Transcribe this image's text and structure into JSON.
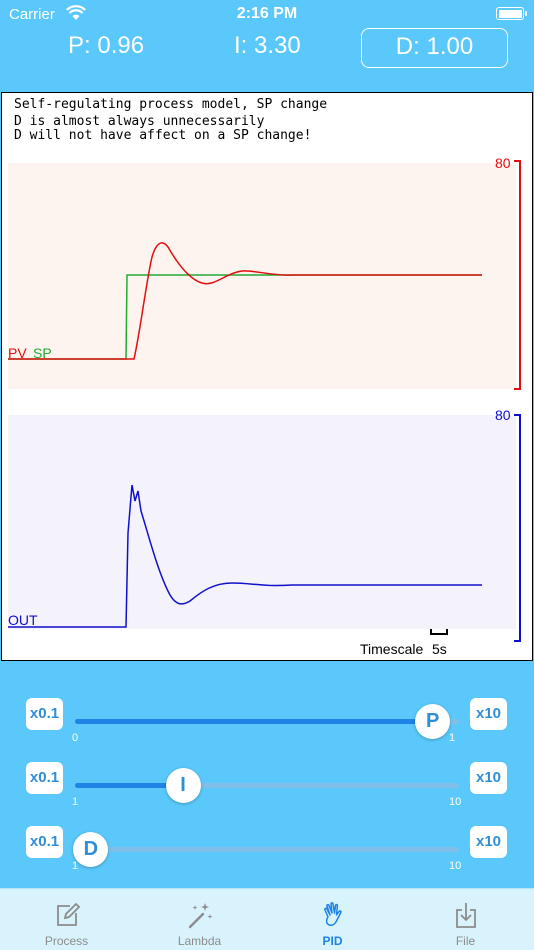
{
  "status_bar": {
    "carrier": "Carrier",
    "time": "2:16 PM"
  },
  "header": {
    "p": "P:  0.96",
    "i": "I:  3.30",
    "d": "D:  1.00"
  },
  "plot": {
    "notes": [
      "Self-regulating process model, SP change",
      "D is almost always unnecessarily",
      "D will not have affect on a SP change!"
    ],
    "top_max": "80",
    "bottom_max": "80",
    "pv_label": "PV",
    "sp_label": "SP",
    "out_label": "OUT",
    "timescale_label": "Timescale",
    "timescale_value": "5s",
    "colors": {
      "pv": "#e01010",
      "sp": "#22aa33",
      "out": "#1010cc"
    }
  },
  "sliders": [
    {
      "key": "P",
      "dec_label": "x0.1",
      "inc_label": "x10",
      "min_label": "0",
      "max_label": "1",
      "position": 0.93
    },
    {
      "key": "I",
      "dec_label": "x0.1",
      "inc_label": "x10",
      "min_label": "1",
      "max_label": "10",
      "position": 0.28
    },
    {
      "key": "D",
      "dec_label": "x0.1",
      "inc_label": "x10",
      "min_label": "1",
      "max_label": "10",
      "position": 0.04
    }
  ],
  "tabs": [
    {
      "label": "Process",
      "icon": "edit-icon",
      "active": false
    },
    {
      "label": "Lambda",
      "icon": "magic-wand-icon",
      "active": false
    },
    {
      "label": "PID",
      "icon": "hand-icon",
      "active": true
    },
    {
      "label": "File",
      "icon": "download-icon",
      "active": false
    }
  ],
  "colors": {
    "background": "#5ac8fa",
    "accent": "#1e82e6",
    "tab_bar": "#d9f3fd"
  }
}
